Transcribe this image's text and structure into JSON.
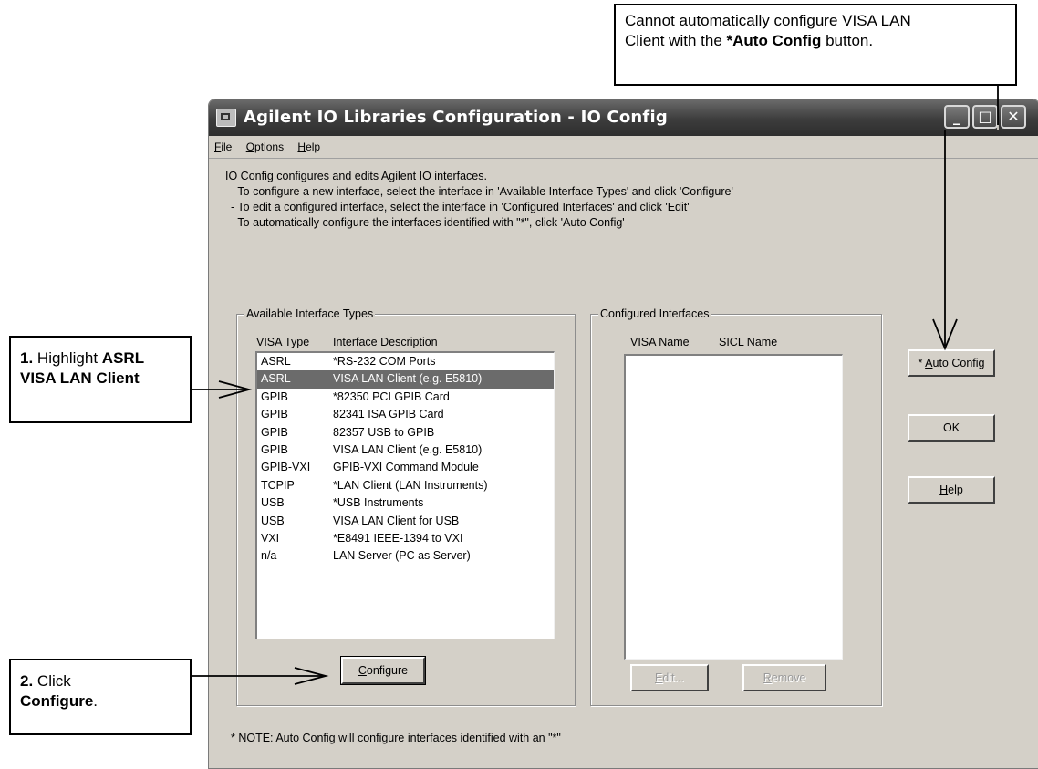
{
  "callouts": {
    "top_line1": "Cannot automatically configure VISA LAN",
    "top_line2_pre": "Client with the ",
    "top_line2_bold": "*Auto Config",
    "top_line2_post": " button.",
    "step1_num": "1.",
    "step1_pre": " Highlight ",
    "step1_bold1": "ASRL",
    "step1_bold2": "VISA LAN Client",
    "step2_num": "2.",
    "step2_pre": " Click",
    "step2_bold": "Configure",
    "step2_post": "."
  },
  "window": {
    "title": "Agilent IO Libraries Configuration - IO Config",
    "minimize": "_",
    "maximize": "□",
    "close": "✕"
  },
  "menu": {
    "file_mn": "F",
    "file_rest": "ile",
    "options_mn": "O",
    "options_rest": "ptions",
    "help_mn": "H",
    "help_rest": "elp"
  },
  "intro": {
    "line1": "IO Config configures and edits Agilent IO interfaces.",
    "line2": "- To configure a new interface, select the interface in 'Available Interface Types'  and click 'Configure'",
    "line3": "- To edit a configured interface, select the interface in 'Configured Interfaces' and click 'Edit'",
    "line4": "- To automatically configure the interfaces identified with \"*\", click 'Auto Config'"
  },
  "available": {
    "group_label": "Available Interface Types",
    "col_type": "VISA Type",
    "col_desc": "Interface Description",
    "selected_index": 1,
    "rows": [
      {
        "type": "ASRL",
        "desc": "*RS-232 COM Ports"
      },
      {
        "type": "ASRL",
        "desc": "VISA LAN Client (e.g. E5810)"
      },
      {
        "type": "GPIB",
        "desc": "*82350 PCI GPIB Card"
      },
      {
        "type": "GPIB",
        "desc": "82341 ISA GPIB Card"
      },
      {
        "type": "GPIB",
        "desc": "82357 USB to GPIB"
      },
      {
        "type": "GPIB",
        "desc": "VISA LAN Client (e.g. E5810)"
      },
      {
        "type": "GPIB-VXI",
        "desc": "GPIB-VXI Command Module"
      },
      {
        "type": "TCPIP",
        "desc": "*LAN Client (LAN Instruments)"
      },
      {
        "type": "USB",
        "desc": "*USB Instruments"
      },
      {
        "type": "USB",
        "desc": "VISA LAN Client for USB"
      },
      {
        "type": "VXI",
        "desc": "*E8491 IEEE-1394 to VXI"
      },
      {
        "type": "n/a",
        "desc": "LAN Server (PC as Server)"
      }
    ]
  },
  "configured": {
    "group_label": "Configured Interfaces",
    "col_visa": "VISA Name",
    "col_sicl": "SICL Name"
  },
  "buttons": {
    "configure_mn": "C",
    "configure_rest": "onfigure",
    "edit_mn": "E",
    "edit_rest": "dit...",
    "remove_mn": "R",
    "remove_rest": "emove",
    "auto_prefix": "* ",
    "auto_mn": "A",
    "auto_rest": "uto Config",
    "ok": "OK",
    "help_mn": "H",
    "help_rest": "elp"
  },
  "note": "* NOTE: Auto Config will configure interfaces identified with an \"*\""
}
